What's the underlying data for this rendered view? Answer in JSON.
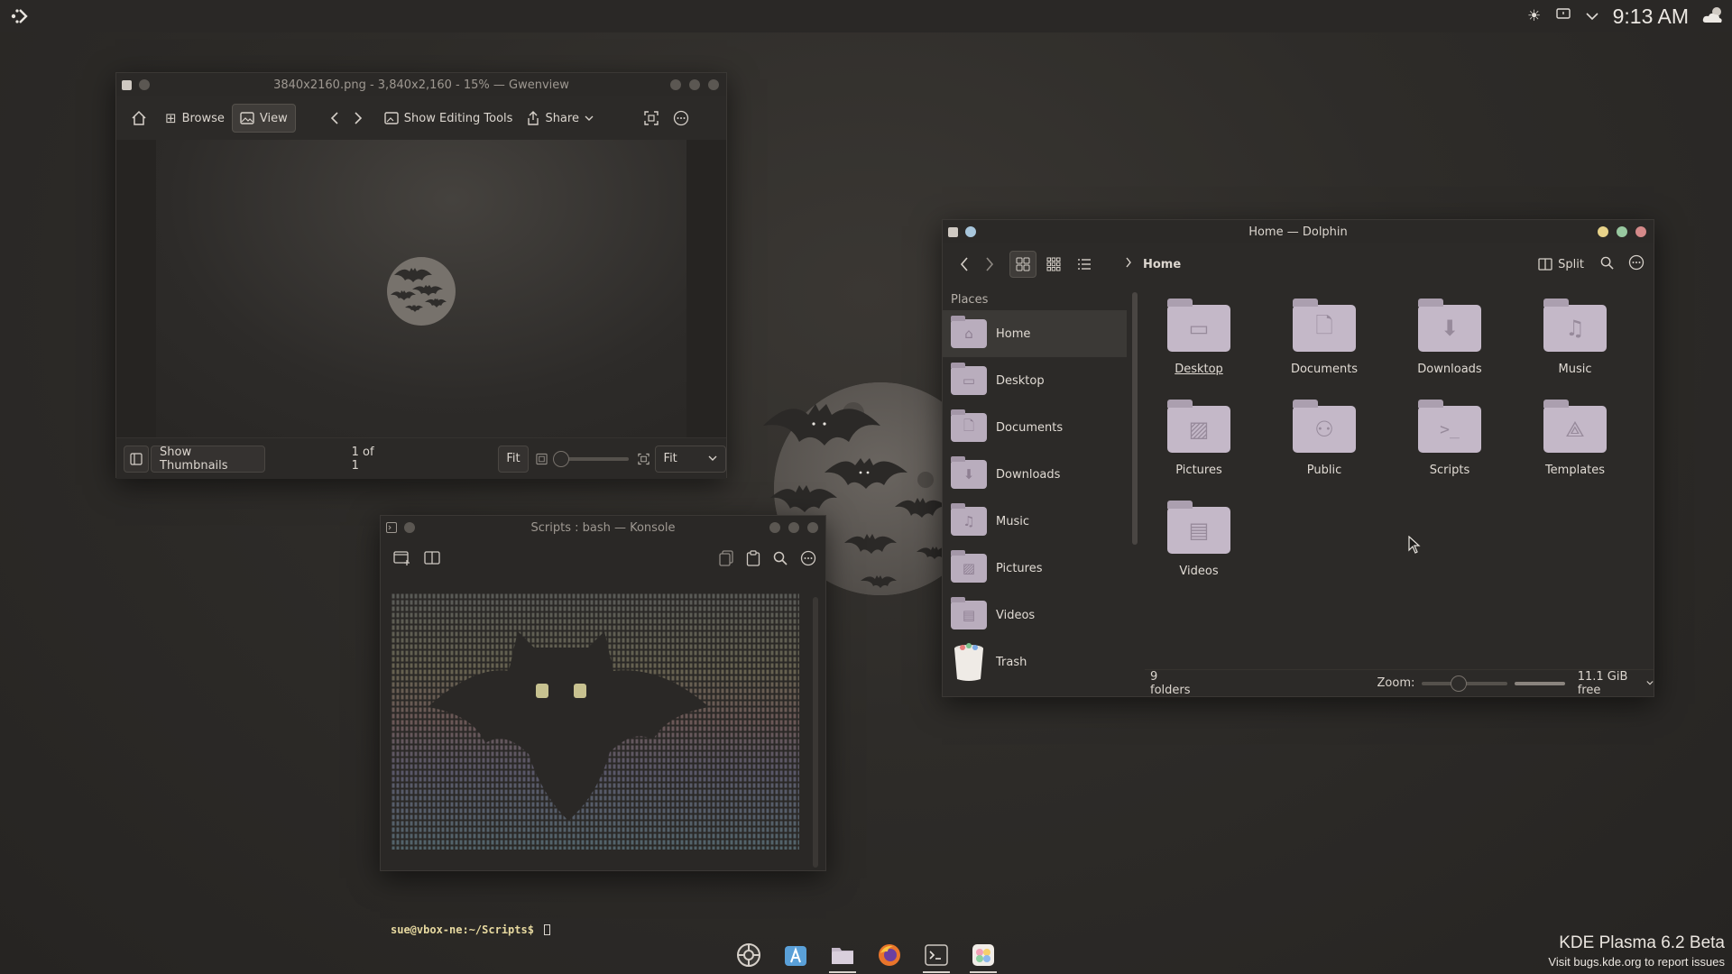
{
  "panel": {
    "launcher_icon": "kde-launcher-icon",
    "tray_icons": [
      "brightness-icon",
      "notifications-icon",
      "expand-tray-icon"
    ],
    "clock": "9:13 AM",
    "weather_icon": "weather-partly-cloudy-icon"
  },
  "gwenview": {
    "title": "3840x2160.png - 3,840x2,160 - 15% — Gwenview",
    "toolbar": {
      "browse": "Browse",
      "view": "View",
      "show_editing_tools": "Show Editing Tools",
      "share": "Share"
    },
    "status": {
      "show_thumbnails": "Show Thumbnails",
      "page_counter": "1 of 1",
      "fit_button": "Fit",
      "zoom_select": "Fit"
    }
  },
  "konsole": {
    "title": "Scripts : bash — Konsole",
    "prompt_user": "sue@vbox-ne",
    "prompt_path": ":~/Scripts$"
  },
  "dolphin": {
    "title": "Home — Dolphin",
    "breadcrumb": "Home",
    "split_label": "Split",
    "places_header": "Places",
    "places": [
      {
        "label": "Home",
        "icon": "home-icon"
      },
      {
        "label": "Desktop",
        "icon": "desktop-icon"
      },
      {
        "label": "Documents",
        "icon": "document-icon"
      },
      {
        "label": "Downloads",
        "icon": "download-icon"
      },
      {
        "label": "Music",
        "icon": "music-icon"
      },
      {
        "label": "Pictures",
        "icon": "picture-icon"
      },
      {
        "label": "Videos",
        "icon": "video-icon"
      },
      {
        "label": "Trash",
        "icon": "trash-icon"
      }
    ],
    "folders": [
      {
        "label": "Desktop",
        "icon": "desktop-icon"
      },
      {
        "label": "Documents",
        "icon": "document-icon"
      },
      {
        "label": "Downloads",
        "icon": "download-icon"
      },
      {
        "label": "Music",
        "icon": "music-icon"
      },
      {
        "label": "Pictures",
        "icon": "picture-icon"
      },
      {
        "label": "Public",
        "icon": "people-icon"
      },
      {
        "label": "Scripts",
        "icon": "terminal-icon"
      },
      {
        "label": "Templates",
        "icon": "template-icon"
      },
      {
        "label": "Videos",
        "icon": "video-icon"
      }
    ],
    "status": {
      "count": "9 folders",
      "zoom_label": "Zoom:",
      "free_space": "11.1 GiB free"
    }
  },
  "dock": {
    "items": [
      "system-settings-icon",
      "discover-icon",
      "dolphin-icon",
      "firefox-icon",
      "konsole-icon",
      "photos-icon"
    ]
  },
  "watermark": {
    "title": "KDE Plasma 6.2 Beta",
    "subtitle": "Visit bugs.kde.org to report issues"
  },
  "colors": {
    "folder": "#c4b8c8",
    "panel_bg": "#2a2826",
    "window_bg": "#2c2a28"
  }
}
